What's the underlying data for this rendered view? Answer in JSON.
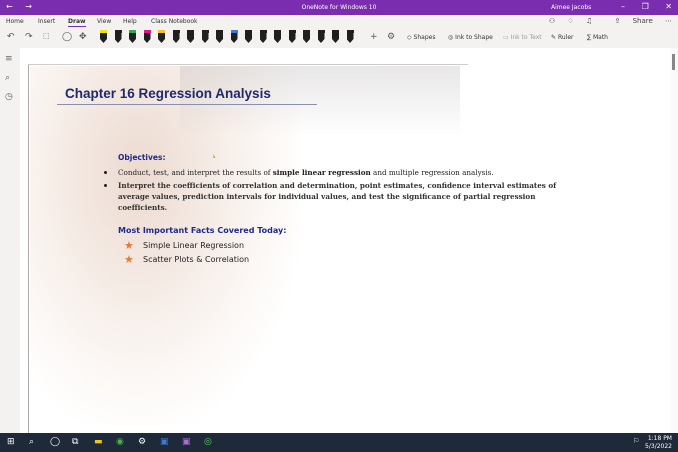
{
  "window": {
    "title": "OneNote for Windows 10",
    "user": "Aimee Jacobs",
    "back_glyph": "←",
    "forward_glyph": "→",
    "minimize_glyph": "–",
    "restore_glyph": "❐",
    "close_glyph": "✕"
  },
  "menu": {
    "tabs": [
      "Home",
      "Insert",
      "Draw",
      "View",
      "Help",
      "Class Notebook"
    ],
    "share": "Share"
  },
  "ribbon": {
    "shapes": "Shapes",
    "ink_to_shape": "Ink to Shape",
    "ink_to_text": "Ink to Text",
    "ruler": "Ruler",
    "math": "Math",
    "pen_caps": [
      "#f2e600",
      "#1f1f1f",
      "#2fa84f",
      "#d81b8a",
      "#f0c419",
      "#1f1f1f",
      "#1f1f1f",
      "#1f1f1f",
      "#1f1f1f",
      "#3a7bd5",
      "#1f1f1f",
      "#1f1f1f",
      "#1f1f1f",
      "#1f1f1f",
      "#1f1f1f",
      "#1f1f1f",
      "#1f1f1f",
      "#1f1f1f"
    ]
  },
  "page": {
    "heading": "Chapter 16 Regression Analysis",
    "objectives_title": "Objectives:",
    "cursor_glyph": "↳",
    "bullet1_pre": "Conduct, test, and interpret the results of ",
    "bullet1_bold": "simple linear regression",
    "bullet1_post": " and multiple regression analysis.",
    "bullet2_line1": "Interpret the coefficients of correlation and determination, point estimates, confidence interval estimates of",
    "bullet2_line2": "average values, prediction intervals for individual values, and test the significance of partial regression",
    "bullet2_line3": "coefficients.",
    "facts_title": "Most Important Facts Covered Today:",
    "facts": [
      "Simple Linear Regression",
      "Scatter Plots & Correlation"
    ]
  },
  "taskbar": {
    "time": "1:18 PM",
    "date": "5/3/2022"
  },
  "colors": {
    "accent": "#7a2dae",
    "heading": "#1f2a6b",
    "star": "#e07b39"
  },
  "icons": [
    "search-icon",
    "clock-icon",
    "windows-start-icon",
    "star-icon"
  ]
}
